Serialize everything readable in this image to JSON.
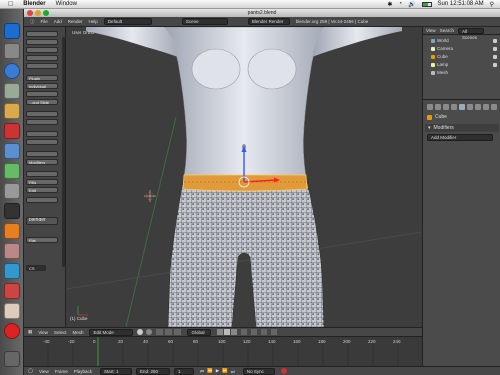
{
  "menubar": {
    "app_name": "Blender",
    "items": [
      "Window"
    ],
    "clock": "Sun 12:51:08 AM"
  },
  "window": {
    "title": "pants2.blend"
  },
  "infoheader": {
    "menus": [
      "File",
      "Add",
      "Render",
      "Help"
    ],
    "layout": "Default",
    "scene": "Scene",
    "render_engine": "Blender Render",
    "stats": "blender.org 259 | Ve:44-2456 | Cube"
  },
  "toolshelf": {
    "buttons": [
      "Plugin",
      "Individual",
      "...and Slide",
      "Modifiers",
      "Fills",
      "Edit",
      "blender",
      "Flat"
    ],
    "value": "CS"
  },
  "viewport": {
    "view_label": "User Ortho",
    "object_label": "(1) Cube"
  },
  "view3d_header": {
    "menus": [
      "View",
      "Select",
      "Mesh"
    ],
    "mode": "Edit Mode",
    "orientation": "Global"
  },
  "timeline": {
    "ticks": [
      "-40",
      "-20",
      "0",
      "20",
      "40",
      "60",
      "80",
      "100",
      "120",
      "140",
      "160",
      "180",
      "200",
      "220",
      "240"
    ],
    "footer_menus": [
      "View",
      "Frame",
      "Playback"
    ],
    "start": "Start: 1",
    "end": "End: 250",
    "current": "1",
    "sync": "No Sync"
  },
  "outliner": {
    "menus": [
      "View",
      "Search",
      "All Scenes"
    ],
    "items": [
      "World",
      "Camera",
      "Cube",
      "Lamp",
      "Mesh"
    ]
  },
  "properties": {
    "object_name": "Cube",
    "panel_title": "Modifiers",
    "add_modifier": "Add Modifier"
  },
  "colors": {
    "viewport_bg": "#3d3d3d",
    "mesh": "#c8cdd8",
    "selected_edge": "#f0a030",
    "panel": "#4b4b4b"
  }
}
